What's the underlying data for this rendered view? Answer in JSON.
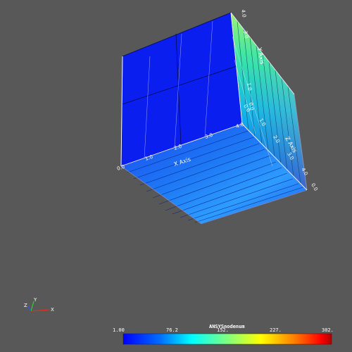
{
  "scene": {
    "background": "#585858",
    "x_axis": {
      "title": "X Axis",
      "ticks": [
        "0.0",
        "1.0",
        "2.0",
        "3.0",
        "4.0"
      ]
    },
    "y_axis": {
      "title": "Y Axis",
      "ticks": [
        "0.0",
        "1.0",
        "2.0",
        "3.0",
        "4.0"
      ]
    },
    "z_axis": {
      "title": "Z Axis",
      "ticks": [
        "0.0",
        "1.0",
        "2.0",
        "3.0",
        "4.0"
      ]
    },
    "x_axis_top_ticks": [
      "1.0",
      "2.0",
      "3.0",
      "4.0"
    ]
  },
  "orientation_triad": {
    "x": "X",
    "y": "Y",
    "z": "Z",
    "x_color": "#e03020",
    "y_color": "#30d030",
    "z_color": "#3050ff"
  },
  "colorbar": {
    "title": "ANSYSnodenum",
    "min": 1.0,
    "max": 302.0,
    "labels": [
      "1.00",
      "76.2",
      "152.",
      "227.",
      "302."
    ],
    "colors": [
      "#0000ff",
      "#00a0ff",
      "#00ffff",
      "#80ff80",
      "#ffff00",
      "#ff8000",
      "#ff0000",
      "#a00000"
    ]
  }
}
